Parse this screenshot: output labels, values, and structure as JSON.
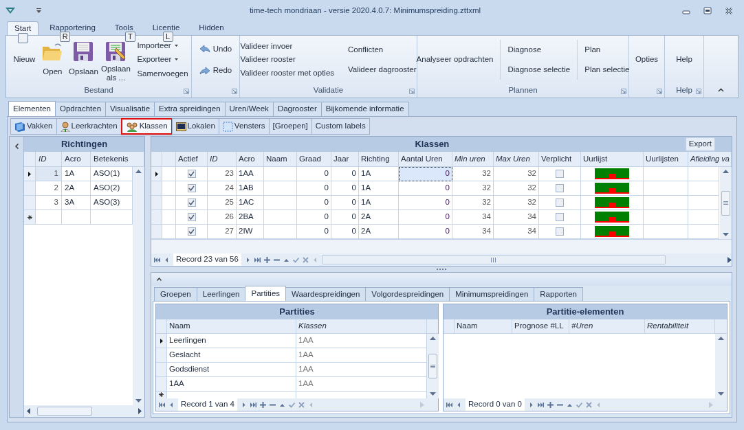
{
  "window": {
    "title": "time-tech mondriaan - versie 2020.4.0.7: Minimumspreiding.zttxml"
  },
  "ribbon_tabs": [
    {
      "label": "Start",
      "selected": true
    },
    {
      "label": "Rapportering",
      "selected": false,
      "key_tip": "R"
    },
    {
      "label": "Tools",
      "selected": false,
      "key_tip": "T"
    },
    {
      "label": "Licentie",
      "selected": false,
      "key_tip": "L"
    },
    {
      "label": "Hidden",
      "selected": false
    }
  ],
  "ribbon_groups": [
    {
      "kind": "file",
      "label": "Bestand",
      "large": [
        {
          "label": "Nieuw"
        },
        {
          "label": "Open"
        },
        {
          "label": "Opslaan"
        },
        {
          "label": "Opslaan als ..."
        }
      ],
      "small": [
        {
          "label": "Importeer",
          "dropdown": true
        },
        {
          "label": "Exporteer",
          "dropdown": true
        },
        {
          "label": "Samenvoegen",
          "dropdown": false
        }
      ]
    },
    {
      "kind": "history",
      "items": [
        "Undo",
        "Redo"
      ]
    },
    {
      "kind": "columns",
      "label": "Validatie",
      "separators": false,
      "columns": [
        [
          "Valideer invoer",
          "Valideer rooster",
          "Valideer rooster met opties"
        ],
        [
          "Conflicten",
          "Valideer dagrooster"
        ]
      ]
    },
    {
      "kind": "columns",
      "label": "Plannen",
      "separators": true,
      "columns": [
        [
          "Analyseer opdrachten"
        ],
        [
          "Diagnose",
          "Diagnose selectie"
        ],
        [
          "Plan",
          "Plan selectie"
        ]
      ]
    },
    {
      "kind": "columns",
      "columns": [
        [
          "Opties"
        ]
      ]
    },
    {
      "kind": "columns",
      "label": "Help",
      "columns": [
        [
          "Help"
        ]
      ]
    }
  ],
  "main_tabs": [
    {
      "label": "Elementen",
      "selected": true
    },
    {
      "label": "Opdrachten",
      "selected": false
    },
    {
      "label": "Visualisatie",
      "selected": false
    },
    {
      "label": "Extra spreidingen",
      "selected": false
    },
    {
      "label": "Uren/Week",
      "selected": false
    },
    {
      "label": "Dagrooster",
      "selected": false
    },
    {
      "label": "Bijkomende informatie",
      "selected": false
    }
  ],
  "sub_tabs": [
    {
      "label": "Vakken",
      "selected": false
    },
    {
      "label": "Leerkrachten",
      "selected": false
    },
    {
      "label": "Klassen",
      "selected": true
    },
    {
      "label": "Lokalen",
      "selected": false
    },
    {
      "label": "Vensters",
      "selected": false
    },
    {
      "label": "[Groepen]",
      "selected": false
    },
    {
      "label": "Custom labels",
      "selected": false
    }
  ],
  "richtingen": {
    "title": "Richtingen",
    "columns": [
      {
        "label": "ID",
        "italic": true,
        "kind": "number"
      },
      {
        "label": "Acro",
        "italic": false,
        "kind": "text"
      },
      {
        "label": "Betekenis",
        "italic": false,
        "kind": "text"
      }
    ],
    "rows": [
      {
        "selected": true,
        "cells": [
          "1",
          "1A",
          "ASO(1)"
        ]
      },
      {
        "selected": false,
        "cells": [
          "2",
          "2A",
          "ASO(2)"
        ]
      },
      {
        "selected": false,
        "cells": [
          "3",
          "3A",
          "ASO(3)"
        ]
      }
    ]
  },
  "klassen": {
    "title": "Klassen",
    "export": "Export",
    "navigator": "Record 23 van 56",
    "columns": [
      {
        "label": "Actief",
        "italic": false,
        "kind": "check"
      },
      {
        "label": "ID",
        "italic": true,
        "kind": "number"
      },
      {
        "label": "Acro",
        "italic": false,
        "kind": "text"
      },
      {
        "label": "Naam",
        "italic": false,
        "kind": "text"
      },
      {
        "label": "Graad",
        "italic": false,
        "kind": "number"
      },
      {
        "label": "Jaar",
        "italic": false,
        "kind": "number"
      },
      {
        "label": "Richting",
        "italic": false,
        "kind": "text"
      },
      {
        "label": "Aantal Uren",
        "italic": false,
        "kind": "number",
        "focused": true
      },
      {
        "label": "Min uren",
        "italic": true,
        "kind": "number"
      },
      {
        "label": "Max Uren",
        "italic": true,
        "kind": "number"
      },
      {
        "label": "Verplicht",
        "italic": false,
        "kind": "check"
      },
      {
        "label": "Uurlijst",
        "italic": false,
        "kind": "graph"
      },
      {
        "label": "Uurlijsten",
        "italic": false,
        "kind": "text"
      },
      {
        "label": "Afleiding va",
        "italic": true,
        "kind": "text"
      }
    ],
    "rows": [
      {
        "selected": true,
        "cells": [
          true,
          "23",
          "1AA",
          null,
          "0",
          "0",
          "1A",
          "0",
          "32",
          "32",
          false,
          null,
          null,
          null
        ]
      },
      {
        "selected": false,
        "cells": [
          true,
          "24",
          "1AB",
          null,
          "0",
          "0",
          "1A",
          "0",
          "32",
          "32",
          false,
          null,
          null,
          null
        ]
      },
      {
        "selected": false,
        "cells": [
          true,
          "25",
          "1AC",
          null,
          "0",
          "0",
          "1A",
          "0",
          "32",
          "32",
          false,
          null,
          null,
          null
        ]
      },
      {
        "selected": false,
        "cells": [
          true,
          "26",
          "2BA",
          null,
          "0",
          "0",
          "2A",
          "0",
          "34",
          "34",
          false,
          null,
          null,
          null
        ]
      },
      {
        "selected": false,
        "cells": [
          true,
          "27",
          "2IW",
          null,
          "0",
          "0",
          "2A",
          "0",
          "34",
          "34",
          false,
          null,
          null,
          null
        ]
      }
    ]
  },
  "detail_tabs": [
    {
      "label": "Groepen",
      "selected": false
    },
    {
      "label": "Leerlingen",
      "selected": false
    },
    {
      "label": "Partities",
      "selected": true
    },
    {
      "label": "Waardespreidingen",
      "selected": false
    },
    {
      "label": "Volgordespreidingen",
      "selected": false
    },
    {
      "label": "Minimumspreidingen",
      "selected": false
    },
    {
      "label": "Rapporten",
      "selected": false
    }
  ],
  "partities": {
    "title": "Partities",
    "navigator": "Record 1 van 4",
    "columns": [
      {
        "label": "Naam",
        "italic": false
      },
      {
        "label": "Klassen",
        "italic": true
      }
    ],
    "rows": [
      {
        "selected": true,
        "cells": [
          "Leerlingen",
          "1AA"
        ]
      },
      {
        "selected": false,
        "cells": [
          "Geslacht",
          "1AA"
        ]
      },
      {
        "selected": false,
        "cells": [
          "Godsdienst",
          "1AA"
        ]
      },
      {
        "selected": false,
        "cells": [
          "1AA",
          "1AA"
        ]
      }
    ]
  },
  "partitie_elementen": {
    "title": "Partitie-elementen",
    "navigator": "Record 0 van 0",
    "columns": [
      {
        "label": "Naam",
        "italic": false
      },
      {
        "label": "Prognose #LL",
        "italic": false
      },
      {
        "label": "#Uren",
        "italic": true
      },
      {
        "label": "Rentabiliteit",
        "italic": true
      }
    ]
  }
}
